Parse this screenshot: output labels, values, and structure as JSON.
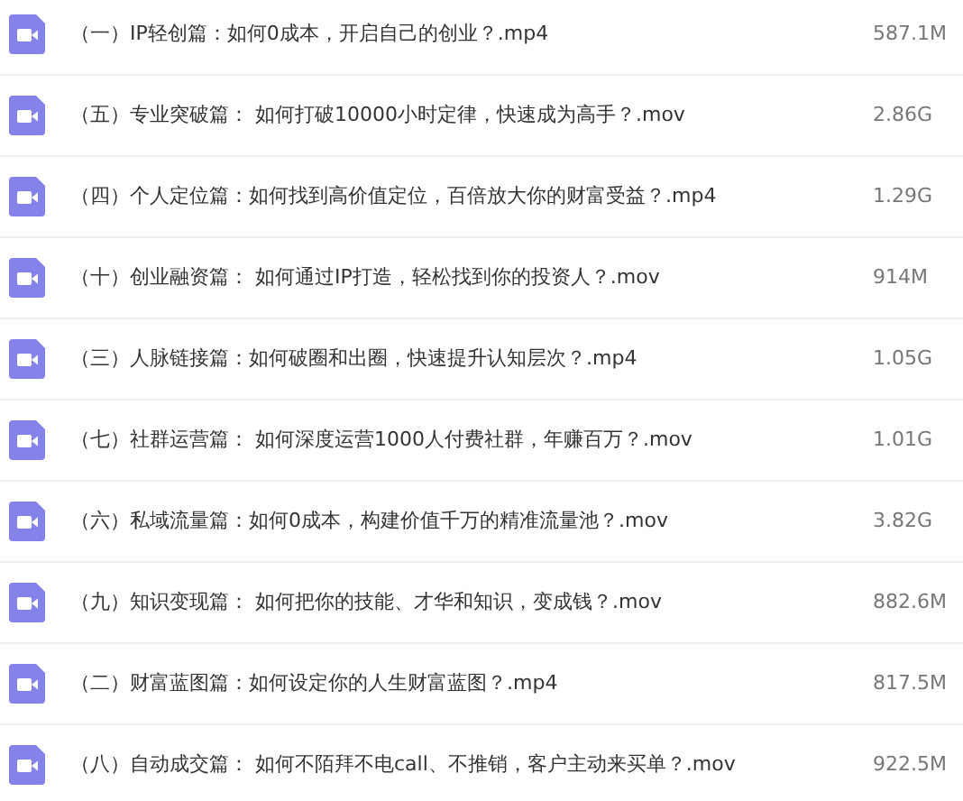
{
  "files": [
    {
      "name": "（一）IP轻创篇：如何0成本，开启自己的创业？.mp4",
      "size": "587.1M"
    },
    {
      "name": "（五）专业突破篇： 如何打破10000小时定律，快速成为高手？.mov",
      "size": "2.86G"
    },
    {
      "name": "（四）个人定位篇：如何找到高价值定位，百倍放大你的财富受益？.mp4",
      "size": "1.29G"
    },
    {
      "name": "（十）创业融资篇： 如何通过IP打造，轻松找到你的投资人？.mov",
      "size": "914M"
    },
    {
      "name": "（三）人脉链接篇：如何破圈和出圈，快速提升认知层次？.mp4",
      "size": "1.05G"
    },
    {
      "name": "（七）社群运营篇： 如何深度运营1000人付费社群，年赚百万？.mov",
      "size": "1.01G"
    },
    {
      "name": "（六）私域流量篇：如何0成本，构建价值千万的精准流量池？.mov",
      "size": "3.82G"
    },
    {
      "name": "（九）知识变现篇： 如何把你的技能、才华和知识，变成钱？.mov",
      "size": "882.6M"
    },
    {
      "name": "（二）财富蓝图篇：如何设定你的人生财富蓝图？.mp4",
      "size": "817.5M"
    },
    {
      "name": "（八）自动成交篇： 如何不陌拜不电call、不推销，客户主动来买单？.mov",
      "size": "922.5M"
    }
  ]
}
